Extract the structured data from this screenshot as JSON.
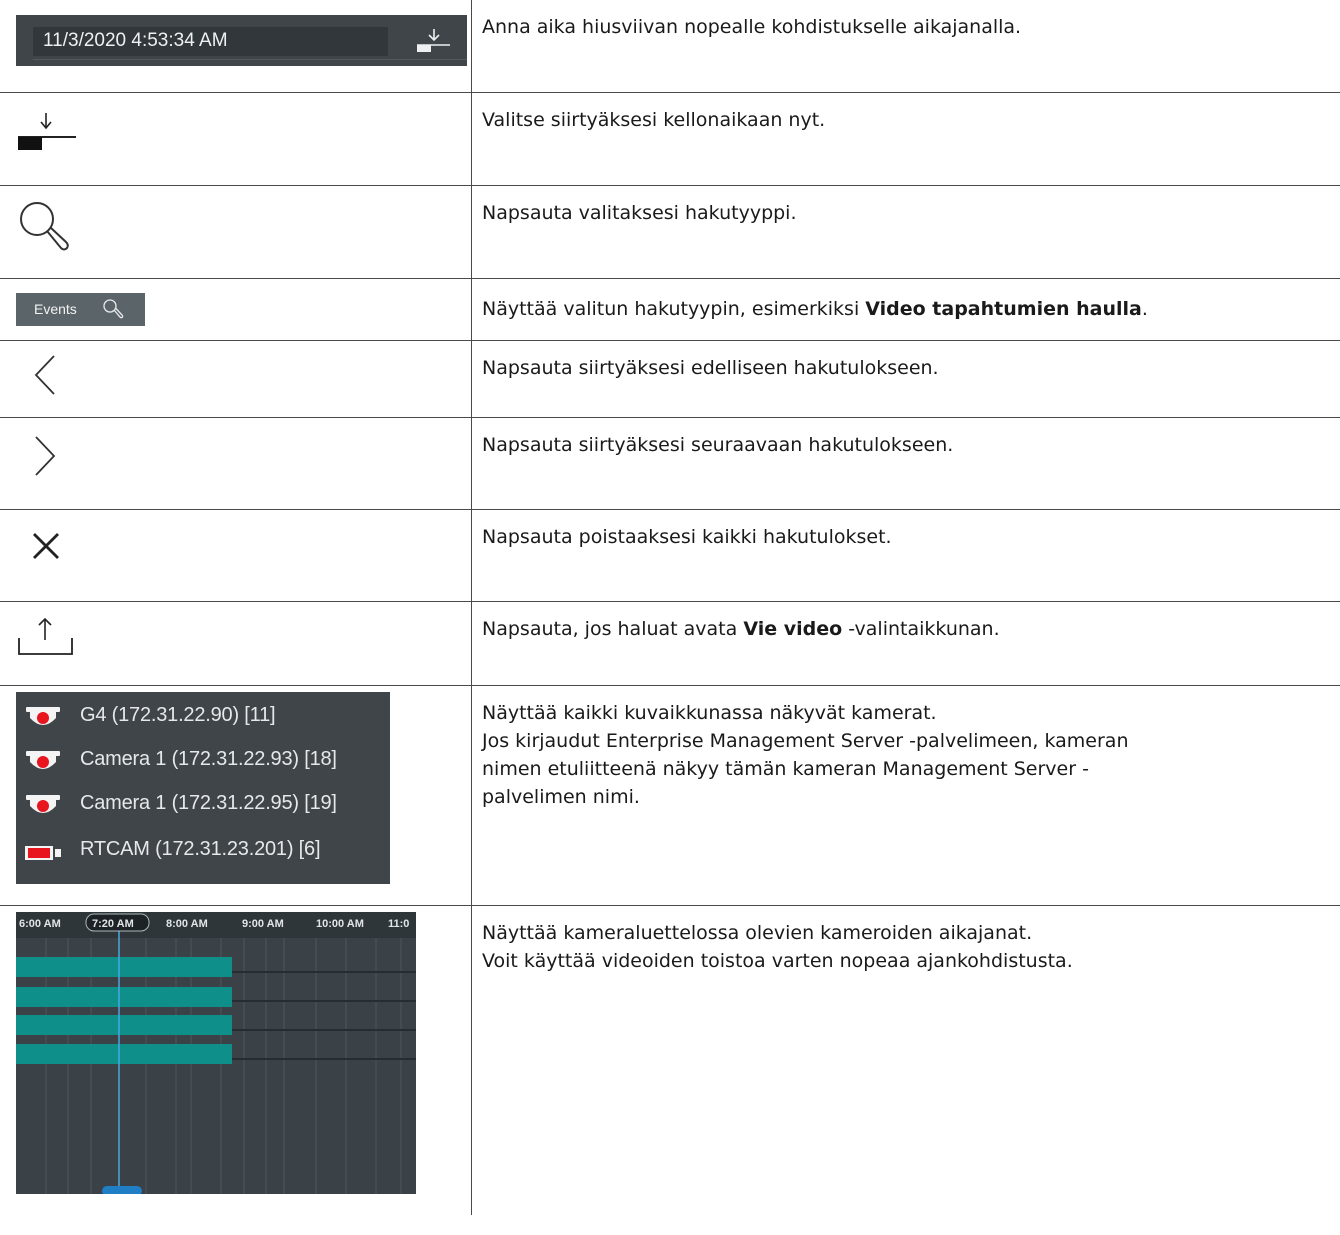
{
  "rows": [
    {
      "id": "time-field",
      "description": "Anna aika hiusviivan nopealle kohdistukselle aikajanalla."
    },
    {
      "id": "go-to-now",
      "description": "Valitse siirtyäksesi kellonaikaan nyt."
    },
    {
      "id": "search",
      "description": "Napsauta valitaksesi hakutyyppi."
    },
    {
      "id": "search-type",
      "description_pre": "Näyttää valitun hakutyypin, esimerkiksi ",
      "description_bold": "Video tapahtumien haulla",
      "description_post": "."
    },
    {
      "id": "previous",
      "description": "Napsauta siirtyäksesi edelliseen hakutulokseen."
    },
    {
      "id": "next",
      "description": "Napsauta siirtyäksesi seuraavaan hakutulokseen."
    },
    {
      "id": "clear",
      "description": "Napsauta poistaaksesi kaikki hakutulokset."
    },
    {
      "id": "export",
      "description_pre": "Napsauta, jos haluat avata ",
      "description_bold": "Vie video",
      "description_post": " -valintaikkunan."
    },
    {
      "id": "camera-list",
      "description_lines": [
        "Näyttää kaikki kuvaikkunassa näkyvät kamerat.",
        "Jos kirjaudut Enterprise Management Server -palvelimeen, kameran",
        "nimen etuliitteenä näkyy tämän kameran Management Server -",
        "palvelimen nimi."
      ]
    },
    {
      "id": "timelines",
      "description_lines": [
        "Näyttää kameraluettelossa olevien kameroiden aikajanat.",
        "Voit käyttää videoiden toistoa varten nopeaa ajankohdistusta."
      ]
    }
  ],
  "time_field": {
    "value": "11/3/2020 4:53:34 AM"
  },
  "search_type": {
    "label": "Events"
  },
  "cameras": [
    {
      "label": "G4 (172.31.22.90) [11]",
      "icon": "dome-camera-icon"
    },
    {
      "label": "Camera 1 (172.31.22.93) [18]",
      "icon": "dome-camera-icon"
    },
    {
      "label": "Camera 1 (172.31.22.95) [19]",
      "icon": "dome-camera-icon"
    },
    {
      "label": "RTCAM (172.31.23.201) [6]",
      "icon": "box-camera-icon"
    }
  ],
  "timeline": {
    "ticks": [
      "6:00 AM",
      "7:20 AM",
      "8:00 AM",
      "9:00 AM",
      "10:00 AM",
      "11:0"
    ],
    "current_time": "7:20 AM",
    "track_color": "#0f8f8a"
  },
  "colors": {
    "panel": "#3f4549",
    "camera_red": "#e8141e"
  }
}
